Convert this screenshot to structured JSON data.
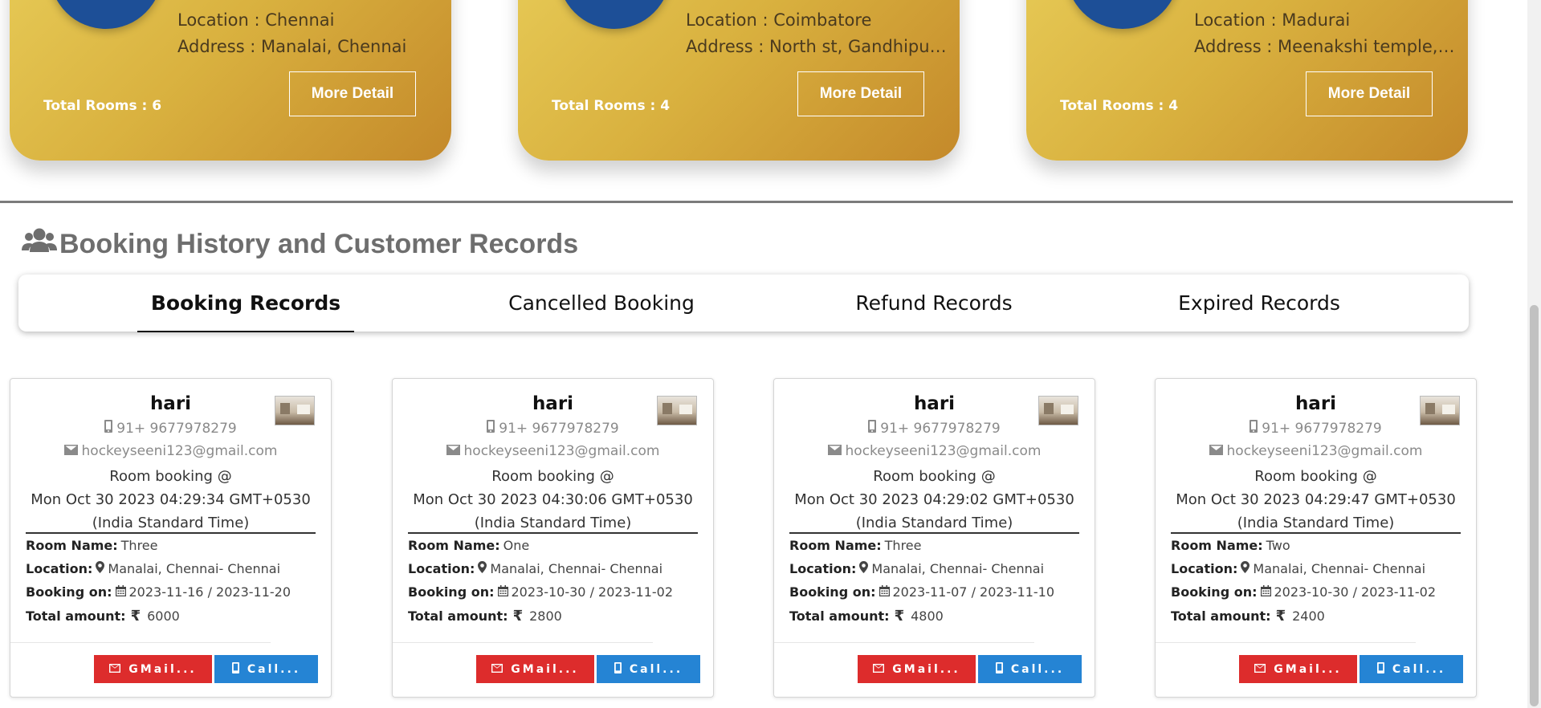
{
  "hotels": [
    {
      "location": "Location : Chennai",
      "address": "Address : Manalai, Chennai",
      "rooms": "Total Rooms : 6",
      "button": "More Detail"
    },
    {
      "location": "Location : Coimbatore",
      "address": "Address : North st, Gandhipuram, Coimbatore",
      "rooms": "Total Rooms : 4",
      "button": "More Detail"
    },
    {
      "location": "Location : Madurai",
      "address": "Address : Meenakshi temple, Madurai",
      "rooms": "Total Rooms : 4",
      "button": "More Detail"
    }
  ],
  "section": {
    "title": "Booking History and Customer Records",
    "icon": "users-icon"
  },
  "tabs": [
    {
      "label": "Booking Records",
      "active": true
    },
    {
      "label": "Cancelled Booking",
      "active": false
    },
    {
      "label": "Refund Records",
      "active": false
    },
    {
      "label": "Expired Records",
      "active": false
    }
  ],
  "bookings": [
    {
      "name": "hari",
      "phone": "91+ 9677978279",
      "email": "hockeyseeni123@gmail.com",
      "booked_prefix": "Room booking @",
      "booked_date": "Mon Oct 30 2023 04:29:34 GMT+0530",
      "booked_tz": "(India Standard Time)",
      "room_label": "Room Name:",
      "room": "Three",
      "location_label": "Location:",
      "location": "Manalai, Chennai- Chennai",
      "booking_label": "Booking on:",
      "dates": "2023-11-16 / 2023-11-20",
      "amount_label": "Total amount:",
      "amount": "6000",
      "gmail": "GMail...",
      "call": "Call..."
    },
    {
      "name": "hari",
      "phone": "91+ 9677978279",
      "email": "hockeyseeni123@gmail.com",
      "booked_prefix": "Room booking @",
      "booked_date": "Mon Oct 30 2023 04:30:06 GMT+0530",
      "booked_tz": "(India Standard Time)",
      "room_label": "Room Name:",
      "room": "One",
      "location_label": "Location:",
      "location": "Manalai, Chennai- Chennai",
      "booking_label": "Booking on:",
      "dates": "2023-10-30 / 2023-11-02",
      "amount_label": "Total amount:",
      "amount": "2800",
      "gmail": "GMail...",
      "call": "Call..."
    },
    {
      "name": "hari",
      "phone": "91+ 9677978279",
      "email": "hockeyseeni123@gmail.com",
      "booked_prefix": "Room booking @",
      "booked_date": "Mon Oct 30 2023 04:29:02 GMT+0530",
      "booked_tz": "(India Standard Time)",
      "room_label": "Room Name:",
      "room": "Three",
      "location_label": "Location:",
      "location": "Manalai, Chennai- Chennai",
      "booking_label": "Booking on:",
      "dates": "2023-11-07 / 2023-11-10",
      "amount_label": "Total amount:",
      "amount": "4800",
      "gmail": "GMail...",
      "call": "Call..."
    },
    {
      "name": "hari",
      "phone": "91+ 9677978279",
      "email": "hockeyseeni123@gmail.com",
      "booked_prefix": "Room booking @",
      "booked_date": "Mon Oct 30 2023 04:29:47 GMT+0530",
      "booked_tz": "(India Standard Time)",
      "room_label": "Room Name:",
      "room": "Two",
      "location_label": "Location:",
      "location": "Manalai, Chennai- Chennai",
      "booking_label": "Booking on:",
      "dates": "2023-10-30 / 2023-11-02",
      "amount_label": "Total amount:",
      "amount": "2400",
      "gmail": "GMail...",
      "call": "Call..."
    }
  ],
  "currency_symbol": "₹",
  "colors": {
    "gold": "#d9b13f",
    "gmail_button": "#dd2c2c",
    "call_button": "#2584d4",
    "heading": "#6e6e6e"
  }
}
